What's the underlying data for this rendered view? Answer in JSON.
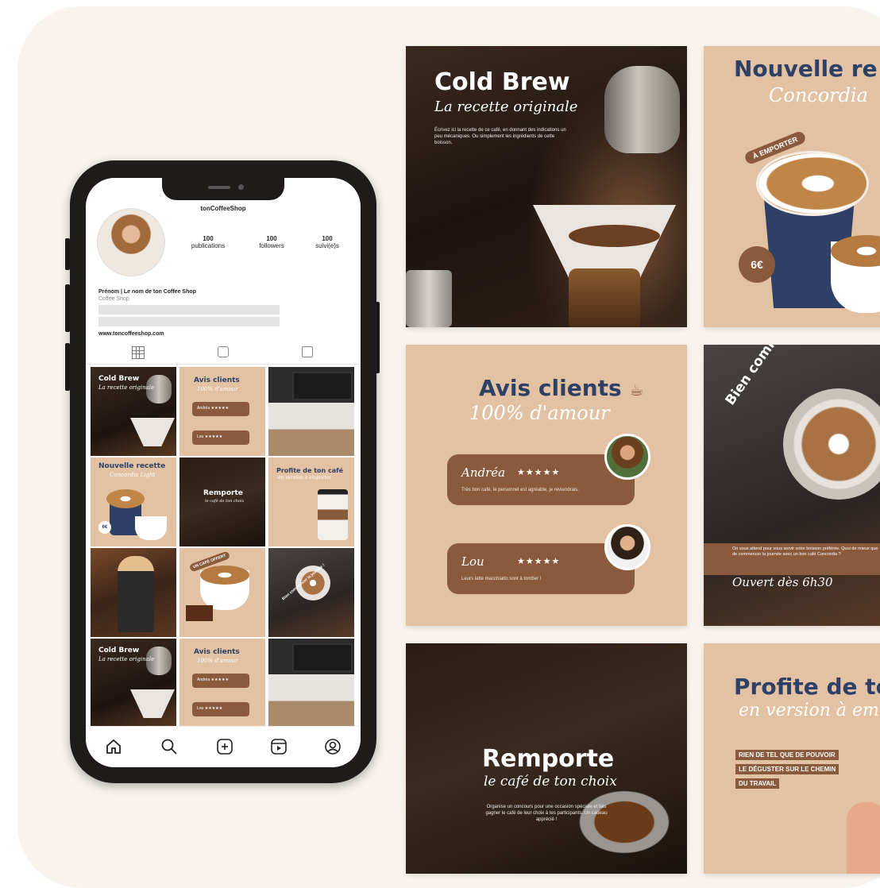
{
  "tiles": {
    "cold_brew": {
      "title": "Cold Brew",
      "subtitle": "La recette originale",
      "body": "Écrivez ici la recette de ce café, en donnant des indications un peu mécaniques. Ou simplement les ingrédients de cette boisson."
    },
    "nouvelle": {
      "title": "Nouvelle re",
      "subtitle": "Concordia",
      "tag": "À EMPORTER",
      "price": "6€"
    },
    "avis": {
      "title": "Avis clients",
      "subtitle": "100% d'amour",
      "reviews": [
        {
          "name": "Andréa",
          "stars": "★★★★★",
          "text": "Très bon café, le personnel est agréable, je reviendrais."
        },
        {
          "name": "Lou",
          "stars": "★★★★★",
          "text": "Leurs latte macchiatto sont à tomber !"
        }
      ]
    },
    "bien": {
      "arc": "Bien commencer la jou",
      "body": "On vous attend pour vous servir votre boisson préférée. Quoi de mieux que de commencer la journée avec un bon café Concordia ?",
      "script": "Ouvert dès 6h30"
    },
    "remporte": {
      "title": "Remporte",
      "subtitle": "le café de ton choix",
      "body": "Organise un concours pour une occasion spéciale et fais gagner le café de leur choix à tes participants. Un cadeau apprécié !"
    },
    "profite": {
      "title": "Profite de to",
      "subtitle": "en version à em",
      "banner": [
        "RIEN DE TEL QUE DE POUVOIR",
        "LE DÉGUSTER SUR LE CHEMIN",
        "DU TRAVAIL"
      ]
    }
  },
  "profile": {
    "username": "tonCoffeeShop",
    "stats": [
      {
        "value": "100",
        "label": "publications"
      },
      {
        "value": "100",
        "label": "followers"
      },
      {
        "value": "100",
        "label": "suivi(e)s"
      }
    ],
    "name_line": "Prénom | Le nom de ton Coffee Shop",
    "category": "Coffee Shop",
    "website": "www.toncoffeeshop.com"
  },
  "grid": {
    "cold_brew": {
      "title": "Cold Brew",
      "sub": "La recette originale"
    },
    "avis": {
      "title": "Avis clients",
      "sub": "100% d'amour",
      "r1": "Andréa ★★★★★",
      "r2": "Lou ★★★★★"
    },
    "nouvelle": {
      "title": "Nouvelle recette",
      "sub": "Concordia Light",
      "price": "6€"
    },
    "remporte": {
      "title": "Remporte",
      "sub": "le café de ton choix"
    },
    "profite": {
      "title": "Profite de ton café",
      "sub": "en version à emporter"
    },
    "offert": {
      "tag": "UN CAFÉ OFFERT"
    },
    "bien": {
      "arc": "Bien commencer la journée !"
    },
    "cold_brew2": {
      "title": "Cold Brew",
      "sub": "La recette originale"
    },
    "avis2": {
      "title": "Avis clients",
      "sub": "100% d'amour",
      "r1": "Andréa ★★★★★",
      "r2": "Lou ★★★★★"
    }
  },
  "icons": [
    "grid-icon",
    "reels-icon",
    "tagged-icon",
    "home-icon",
    "search-icon",
    "add-icon",
    "reels-nav-icon",
    "profile-icon"
  ],
  "colors": {
    "navy": "#2e4066",
    "brown": "#8a5a3c",
    "kraft": "#e2c2a3",
    "cream": "#f8f3ec"
  }
}
